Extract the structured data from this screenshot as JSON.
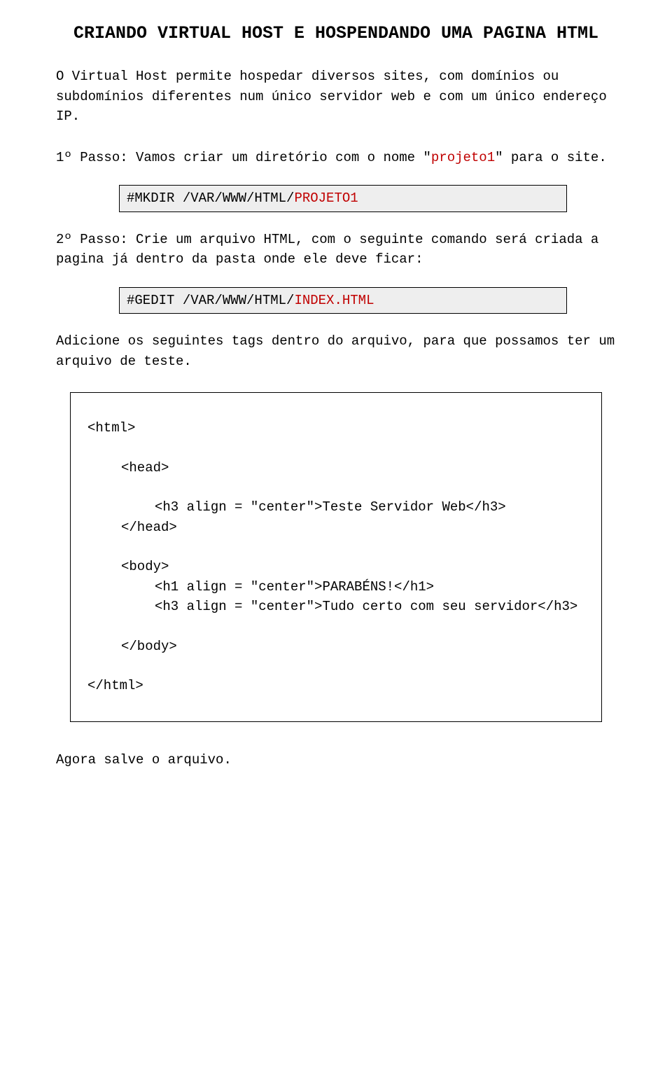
{
  "title": "CRIANDO VIRTUAL HOST E HOSPENDANDO UMA PAGINA HTML",
  "intro": "O Virtual Host permite hospedar diversos sites, com domínios ou subdomínios diferentes num único servidor web e com um único endereço IP.",
  "step1_a": "1º Passo: Vamos criar um diretório com o nome \"",
  "step1_hl": "projeto1",
  "step1_b": "\" para o site.",
  "cmd1_a": "#MKDIR /VAR/WWW/HTML/",
  "cmd1_hl": "PROJETO1",
  "step2": "2º Passo: Crie um arquivo HTML, com o seguinte comando será criada a pagina já dentro da pasta onde ele deve ficar:",
  "cmd2_a": "#GEDIT /VAR/WWW/HTML/",
  "cmd2_hl": "INDEX.HTML",
  "para3": "Adicione os seguintes tags dentro do arquivo, para que possamos ter um arquivo de teste.",
  "code": {
    "open_html": "<html>",
    "open_head": "<head>",
    "h3_a": "<h3 align = \"center\">Teste Servidor Web</h3>",
    "close_head": "</head>",
    "open_body": "<body>",
    "h1": "<h1 align = \"center\">PARABÉNS!</h1>",
    "h3_b": "<h3 align = \"center\">Tudo certo com seu servidor</h3>",
    "close_body": "</body>",
    "close_html": "</html>"
  },
  "outro": "Agora salve o arquivo."
}
